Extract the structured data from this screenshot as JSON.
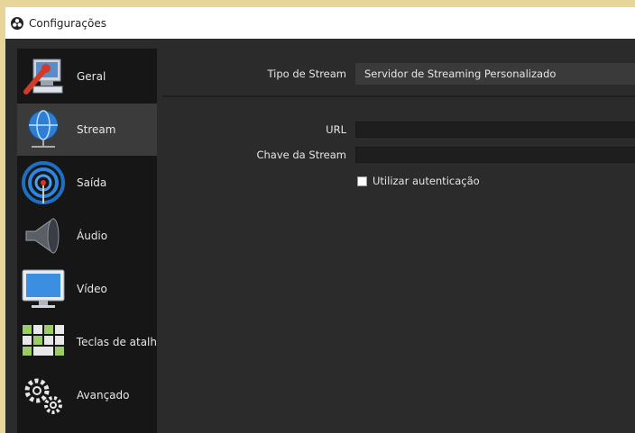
{
  "window": {
    "title": "Configurações"
  },
  "sidebar": {
    "items": [
      {
        "label": "Geral",
        "icon": "wrench-monitor-icon",
        "selected": false
      },
      {
        "label": "Stream",
        "icon": "globe-network-icon",
        "selected": true
      },
      {
        "label": "Saída",
        "icon": "broadcast-antenna-icon",
        "selected": false
      },
      {
        "label": "Áudio",
        "icon": "speaker-icon",
        "selected": false
      },
      {
        "label": "Vídeo",
        "icon": "monitor-icon",
        "selected": false
      },
      {
        "label": "Teclas de atalh",
        "icon": "keyboard-icon",
        "selected": false
      },
      {
        "label": "Avançado",
        "icon": "gears-icon",
        "selected": false
      }
    ]
  },
  "stream": {
    "stream_type_label": "Tipo de Stream",
    "stream_type_value": "Servidor de Streaming Personalizado",
    "url_label": "URL",
    "url_value": "",
    "key_label": "Chave da Stream",
    "key_value": "",
    "auth_label": "Utilizar autenticação",
    "auth_checked": false
  },
  "colors": {
    "background": "#2b2b2b",
    "sidebar": "#161616",
    "selected": "#3b3b3b",
    "text": "#e6e6e6"
  }
}
